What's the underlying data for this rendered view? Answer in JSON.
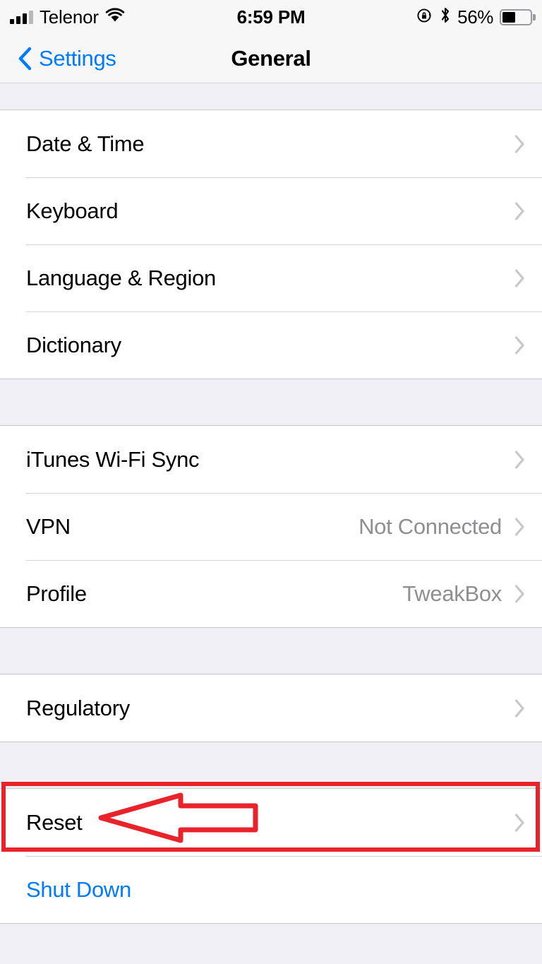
{
  "status_bar": {
    "carrier": "Telenor",
    "signal_icon": "cellular-signal-icon",
    "signal_bars_filled": 3,
    "signal_bars_total": 4,
    "wifi_icon": "wifi-icon",
    "time": "6:59 PM",
    "rotation_lock_icon": "rotation-lock-icon",
    "bluetooth_icon": "bluetooth-icon",
    "battery_percent": "56%",
    "battery_level": 56,
    "battery_icon": "battery-icon"
  },
  "nav_bar": {
    "back_label": "Settings",
    "back_icon": "chevron-left-icon",
    "title": "General"
  },
  "sections": [
    {
      "name": "localization",
      "rows": [
        {
          "label": "Date & Time",
          "value": "",
          "chevron": true,
          "style": "default"
        },
        {
          "label": "Keyboard",
          "value": "",
          "chevron": true,
          "style": "default"
        },
        {
          "label": "Language & Region",
          "value": "",
          "chevron": true,
          "style": "default"
        },
        {
          "label": "Dictionary",
          "value": "",
          "chevron": true,
          "style": "default"
        }
      ]
    },
    {
      "name": "connectivity",
      "rows": [
        {
          "label": "iTunes Wi-Fi Sync",
          "value": "",
          "chevron": true,
          "style": "default"
        },
        {
          "label": "VPN",
          "value": "Not Connected",
          "chevron": true,
          "style": "default"
        },
        {
          "label": "Profile",
          "value": "TweakBox",
          "chevron": true,
          "style": "default"
        }
      ]
    },
    {
      "name": "regulatory",
      "rows": [
        {
          "label": "Regulatory",
          "value": "",
          "chevron": true,
          "style": "default"
        }
      ]
    },
    {
      "name": "reset",
      "rows": [
        {
          "label": "Reset",
          "value": "",
          "chevron": true,
          "style": "default"
        },
        {
          "label": "Shut Down",
          "value": "",
          "chevron": false,
          "style": "link"
        }
      ]
    }
  ],
  "annotation": {
    "type": "highlight-box-with-arrow",
    "target": "Reset",
    "color": "#e8232a"
  },
  "colors": {
    "accent_blue": "#007aff",
    "annotation_red": "#e8232a",
    "group_background": "#ffffff",
    "page_background": "#efeff4",
    "secondary_text": "#8e8e93",
    "chevron_gray": "#c7c7cc"
  }
}
